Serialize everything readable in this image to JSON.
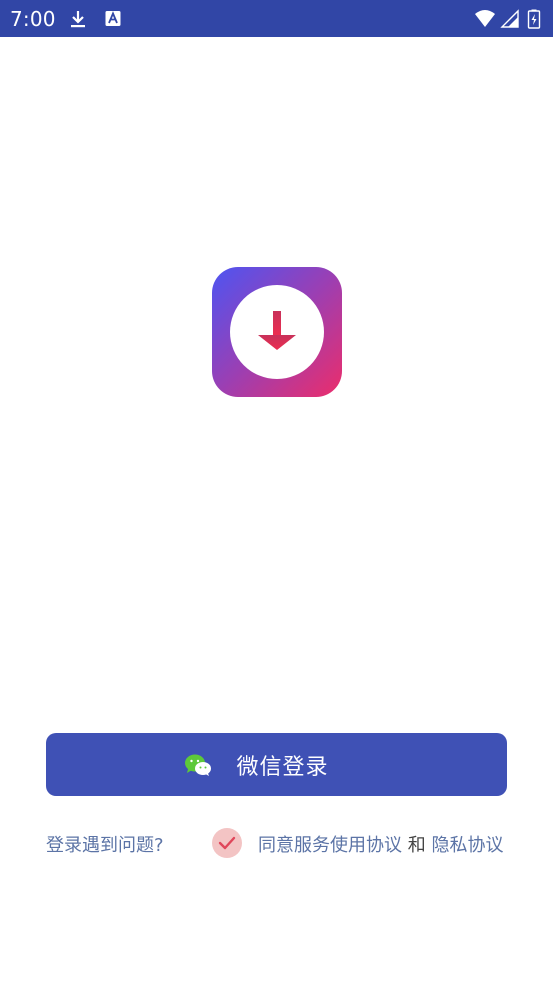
{
  "status_bar": {
    "time": "7:00",
    "background": "#3146a6",
    "icons": [
      "download-icon",
      "a-icon",
      "wifi-icon",
      "signal-icon",
      "battery-icon"
    ]
  },
  "app": {
    "logo_icon": "download-arrow-icon",
    "logo_colors": [
      "#4d55f2",
      "#9b3fb3",
      "#ec2d6a"
    ]
  },
  "login": {
    "button_label": "微信登录",
    "button_color": "#3f51b5",
    "icon": "wechat-icon"
  },
  "footer": {
    "help_text": "登录遇到问题?",
    "agree_checked": true,
    "agree_prefix": "同意服务使用协议",
    "and_text": "和",
    "privacy_text": "隐私协议",
    "link_color": "#5c74a6"
  }
}
